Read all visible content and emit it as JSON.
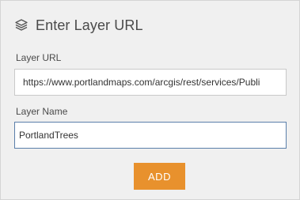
{
  "header": {
    "icon": "layers-icon",
    "title": "Enter Layer URL"
  },
  "form": {
    "url_label": "Layer URL",
    "url_value": "https://www.portlandmaps.com/arcgis/rest/services/Publi",
    "name_label": "Layer Name",
    "name_value": "PortlandTrees"
  },
  "actions": {
    "add_label": "ADD"
  },
  "colors": {
    "accent": "#e8912d",
    "background": "#f0f0f0",
    "focus_border": "#5b7faa"
  }
}
